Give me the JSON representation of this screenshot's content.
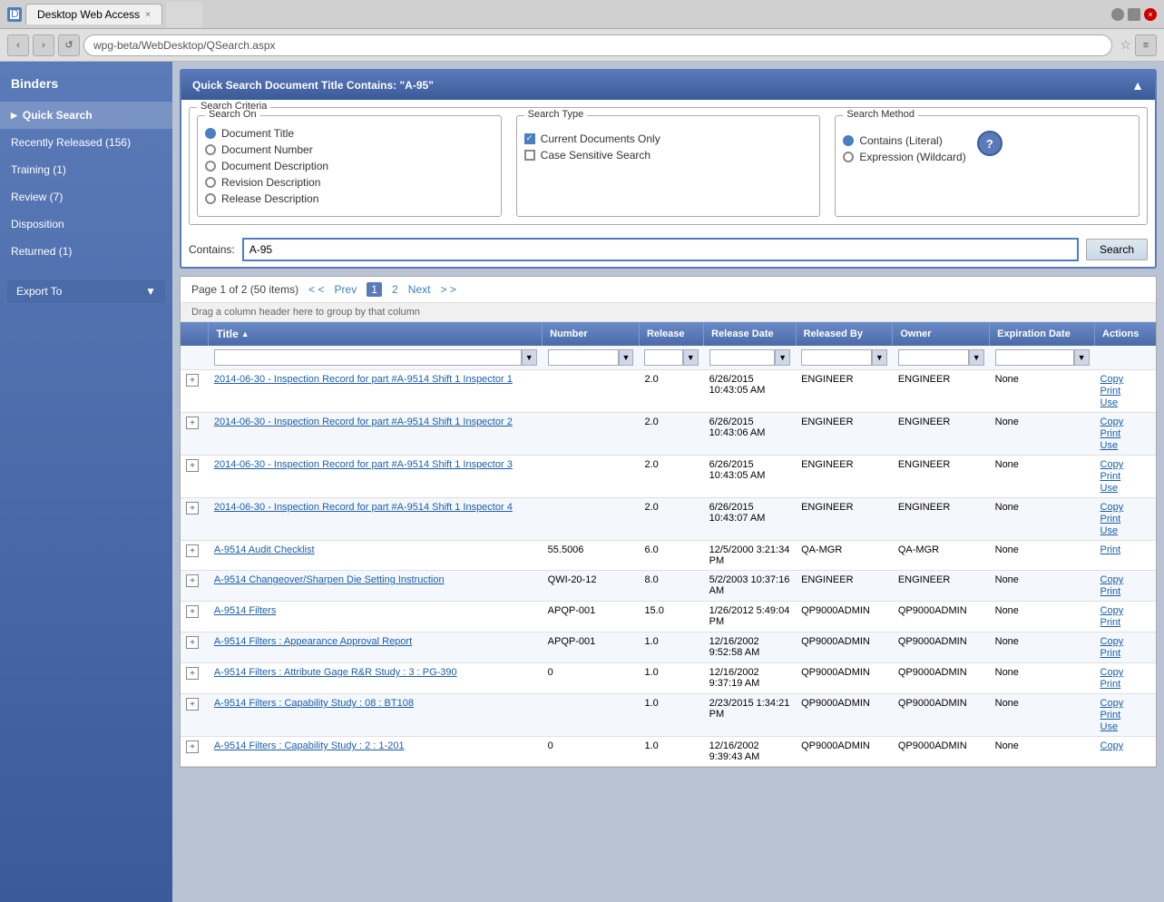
{
  "browser": {
    "tab_label": "Desktop Web Access",
    "tab_close": "×",
    "url": "wpg-beta/WebDesktop/QSearch.aspx",
    "back": "‹",
    "forward": "›",
    "refresh": "↺"
  },
  "sidebar": {
    "title": "Binders",
    "items": [
      {
        "id": "quick-search",
        "label": "Quick Search",
        "active": true
      },
      {
        "id": "recently-released",
        "label": "Recently Released (156)",
        "active": false
      },
      {
        "id": "training",
        "label": "Training (1)",
        "active": false
      },
      {
        "id": "review",
        "label": "Review (7)",
        "active": false
      },
      {
        "id": "disposition",
        "label": "Disposition",
        "active": false
      },
      {
        "id": "returned",
        "label": "Returned (1)",
        "active": false
      }
    ],
    "export_label": "Export To",
    "export_arrow": "▼"
  },
  "search_panel": {
    "header": "Quick Search Document Title Contains: \"A-95\"",
    "collapse_icon": "▲",
    "criteria_legend": "Search Criteria",
    "search_on": {
      "legend": "Search On",
      "options": [
        {
          "label": "Document Title",
          "selected": true
        },
        {
          "label": "Document Number",
          "selected": false
        },
        {
          "label": "Document Description",
          "selected": false
        },
        {
          "label": "Revision Description",
          "selected": false
        },
        {
          "label": "Release Description",
          "selected": false
        }
      ]
    },
    "search_type": {
      "legend": "Search Type",
      "options": [
        {
          "label": "Current Documents Only",
          "checked": true
        },
        {
          "label": "Case Sensitive Search",
          "checked": false
        }
      ]
    },
    "search_method": {
      "legend": "Search Method",
      "options": [
        {
          "label": "Contains (Literal)",
          "selected": true
        },
        {
          "label": "Expression (Wildcard)",
          "selected": false
        }
      ],
      "help_label": "?"
    },
    "contains_label": "Contains:",
    "contains_value": "A-95",
    "search_btn": "Search"
  },
  "results": {
    "pagination": {
      "text": "Page 1 of 2 (50 items)",
      "prev_arrows": "< <",
      "prev_label": "Prev",
      "page1": "1",
      "page2": "2",
      "next_label": "Next",
      "next_arrows": "> >"
    },
    "drag_hint": "Drag a column header here to group by that column",
    "columns": [
      "",
      "Title",
      "Number",
      "Release",
      "Release Date",
      "Released By",
      "Owner",
      "Expiration Date",
      "Actions"
    ],
    "rows": [
      {
        "title": "2014-06-30 - Inspection Record for part #A-9514 Shift 1 Inspector 1",
        "number": "",
        "release": "2.0",
        "release_date": "6/26/2015 10:43:05 AM",
        "released_by": "ENGINEER",
        "owner": "ENGINEER",
        "expiration_date": "None",
        "actions": [
          "Copy",
          "Print",
          "Use"
        ]
      },
      {
        "title": "2014-06-30 - Inspection Record for part #A-9514 Shift 1 Inspector 2",
        "number": "",
        "release": "2.0",
        "release_date": "6/26/2015 10:43:06 AM",
        "released_by": "ENGINEER",
        "owner": "ENGINEER",
        "expiration_date": "None",
        "actions": [
          "Copy",
          "Print",
          "Use"
        ]
      },
      {
        "title": "2014-06-30 - Inspection Record for part #A-9514 Shift 1 Inspector 3",
        "number": "",
        "release": "2.0",
        "release_date": "6/26/2015 10:43:05 AM",
        "released_by": "ENGINEER",
        "owner": "ENGINEER",
        "expiration_date": "None",
        "actions": [
          "Copy",
          "Print",
          "Use"
        ]
      },
      {
        "title": "2014-06-30 - Inspection Record for part #A-9514 Shift 1 Inspector 4",
        "number": "",
        "release": "2.0",
        "release_date": "6/26/2015 10:43:07 AM",
        "released_by": "ENGINEER",
        "owner": "ENGINEER",
        "expiration_date": "None",
        "actions": [
          "Copy",
          "Print",
          "Use"
        ]
      },
      {
        "title": "A-9514 Audit Checklist",
        "number": "55.5006",
        "release": "6.0",
        "release_date": "12/5/2000 3:21:34 PM",
        "released_by": "QA-MGR",
        "owner": "QA-MGR",
        "expiration_date": "None",
        "actions": [
          "Print"
        ]
      },
      {
        "title": "A-9514 Changeover/Sharpen Die Setting Instruction",
        "number": "QWI-20-12",
        "release": "8.0",
        "release_date": "5/2/2003 10:37:16 AM",
        "released_by": "ENGINEER",
        "owner": "ENGINEER",
        "expiration_date": "None",
        "actions": [
          "Copy",
          "Print"
        ]
      },
      {
        "title": "A-9514 Filters",
        "number": "APQP-001",
        "release": "15.0",
        "release_date": "1/26/2012 5:49:04 PM",
        "released_by": "QP9000ADMIN",
        "owner": "QP9000ADMIN",
        "expiration_date": "None",
        "actions": [
          "Copy",
          "Print"
        ]
      },
      {
        "title": "A-9514 Filters : Appearance Approval Report",
        "number": "APQP-001",
        "release": "1.0",
        "release_date": "12/16/2002 9:52:58 AM",
        "released_by": "QP9000ADMIN",
        "owner": "QP9000ADMIN",
        "expiration_date": "None",
        "actions": [
          "Copy",
          "Print"
        ]
      },
      {
        "title": "A-9514 Filters : Attribute Gage R&R Study : 3 : PG-390",
        "number": "0",
        "release": "1.0",
        "release_date": "12/16/2002 9:37:19 AM",
        "released_by": "QP9000ADMIN",
        "owner": "QP9000ADMIN",
        "expiration_date": "None",
        "actions": [
          "Copy",
          "Print"
        ]
      },
      {
        "title": "A-9514 Filters : Capability Study : 08 : BT108",
        "number": "",
        "release": "1.0",
        "release_date": "2/23/2015 1:34:21 PM",
        "released_by": "QP9000ADMIN",
        "owner": "QP9000ADMIN",
        "expiration_date": "None",
        "actions": [
          "Copy",
          "Print",
          "Use"
        ]
      },
      {
        "title": "A-9514 Filters : Capability Study : 2 : 1-201",
        "number": "0",
        "release": "1.0",
        "release_date": "12/16/2002 9:39:43 AM",
        "released_by": "QP9000ADMIN",
        "owner": "QP9000ADMIN",
        "expiration_date": "None",
        "actions": [
          "Copy"
        ]
      }
    ]
  }
}
